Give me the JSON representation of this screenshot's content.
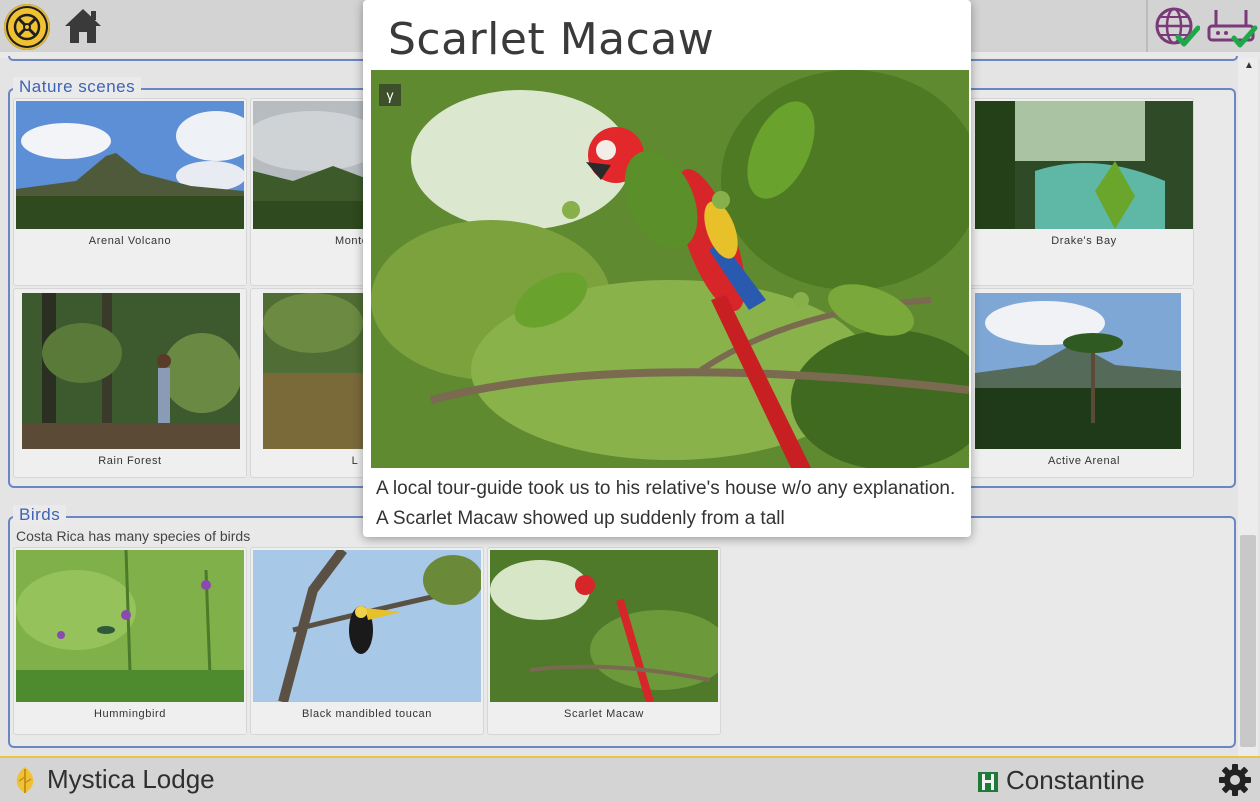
{
  "sections": {
    "nature": {
      "title": "Nature scenes",
      "items": [
        {
          "caption": "Arenal Volcano"
        },
        {
          "caption": "Monteverde"
        },
        {
          "caption": "Drake's Bay"
        },
        {
          "caption": "Rain Forest"
        },
        {
          "caption": "L"
        },
        {
          "caption": "Active Arenal"
        }
      ]
    },
    "birds": {
      "title": "Birds",
      "description": "Costa Rica has many species of birds",
      "items": [
        {
          "caption": "Hummingbird"
        },
        {
          "caption": "Black mandibled toucan"
        },
        {
          "caption": "Scarlet Macaw"
        }
      ]
    }
  },
  "modal": {
    "title": "Scarlet Macaw",
    "badge": "γ",
    "text": "A local tour-guide took us to his relative's house w/o any explanation. A Scarlet Macaw showed up suddenly from a tall"
  },
  "footer": {
    "lodge": "Mystica Lodge",
    "user": "Constantine"
  },
  "icons": {
    "logo": "logo-icon",
    "home": "home-icon",
    "globe": "globe-check-icon",
    "router": "router-check-icon",
    "lodge": "leaf-icon",
    "user": "user-badge-icon",
    "settings": "gear-icon"
  },
  "colors": {
    "accent_blue": "#6b86c4",
    "brand_gold": "#f0c233",
    "check_green": "#1fa84a"
  }
}
